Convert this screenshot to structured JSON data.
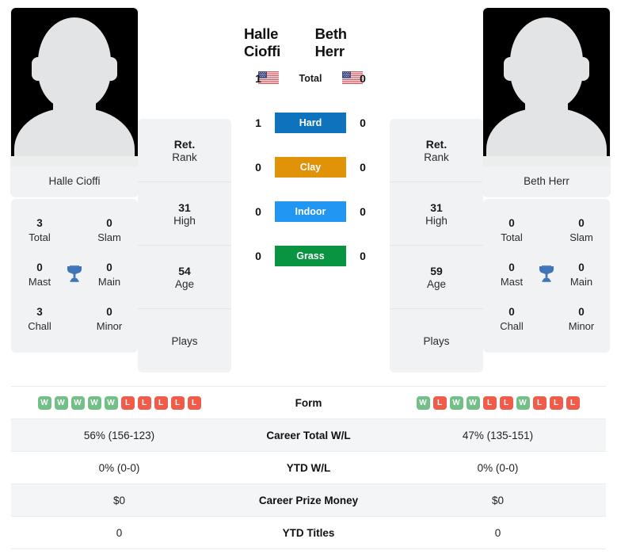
{
  "players": {
    "left": {
      "name": "Halle Cioffi",
      "card_name": "Halle Cioffi",
      "flag": "us-flag-icon",
      "titles": {
        "total": {
          "value": "3",
          "label": "Total"
        },
        "slam": {
          "value": "0",
          "label": "Slam"
        },
        "mast": {
          "value": "0",
          "label": "Mast"
        },
        "main": {
          "value": "0",
          "label": "Main"
        },
        "chall": {
          "value": "3",
          "label": "Chall"
        },
        "minor": {
          "value": "0",
          "label": "Minor"
        }
      },
      "info": {
        "rank_value": "Ret.",
        "rank_label": "Rank",
        "high_value": "31",
        "high_label": "High",
        "age_value": "54",
        "age_label": "Age",
        "plays_label": "Plays"
      },
      "form": [
        "W",
        "W",
        "W",
        "W",
        "W",
        "L",
        "L",
        "L",
        "L",
        "L"
      ],
      "career_total_wl": "56% (156-123)",
      "ytd_wl": "0% (0-0)",
      "career_prize_money": "$0",
      "ytd_titles": "0"
    },
    "right": {
      "name": "Beth Herr",
      "card_name": "Beth Herr",
      "flag": "us-flag-icon",
      "titles": {
        "total": {
          "value": "0",
          "label": "Total"
        },
        "slam": {
          "value": "0",
          "label": "Slam"
        },
        "mast": {
          "value": "0",
          "label": "Mast"
        },
        "main": {
          "value": "0",
          "label": "Main"
        },
        "chall": {
          "value": "0",
          "label": "Chall"
        },
        "minor": {
          "value": "0",
          "label": "Minor"
        }
      },
      "info": {
        "rank_value": "Ret.",
        "rank_label": "Rank",
        "high_value": "31",
        "high_label": "High",
        "age_value": "59",
        "age_label": "Age",
        "plays_label": "Plays"
      },
      "form": [
        "W",
        "L",
        "W",
        "W",
        "L",
        "L",
        "W",
        "L",
        "L",
        "L"
      ],
      "career_total_wl": "47% (135-151)",
      "ytd_wl": "0% (0-0)",
      "career_prize_money": "$0",
      "ytd_titles": "0"
    }
  },
  "surfaces": [
    {
      "label": "Total",
      "left": "1",
      "right": "0",
      "color": "transparent",
      "text_color": "#1a1a1a"
    },
    {
      "label": "Hard",
      "left": "1",
      "right": "0",
      "color": "#0f72bd",
      "text_color": "#ffffff"
    },
    {
      "label": "Clay",
      "left": "0",
      "right": "0",
      "color": "#e09209",
      "text_color": "#ffffff"
    },
    {
      "label": "Indoor",
      "left": "0",
      "right": "0",
      "color": "#2196f3",
      "text_color": "#ffffff"
    },
    {
      "label": "Grass",
      "left": "0",
      "right": "0",
      "color": "#089440",
      "text_color": "#ffffff"
    }
  ],
  "table_rows": [
    {
      "label": "Form",
      "type": "form"
    },
    {
      "label": "Career Total W/L",
      "type": "text",
      "key": "career_total_wl"
    },
    {
      "label": "YTD W/L",
      "type": "text",
      "key": "ytd_wl"
    },
    {
      "label": "Career Prize Money",
      "type": "text",
      "key": "career_prize_money"
    },
    {
      "label": "YTD Titles",
      "type": "text",
      "key": "ytd_titles"
    }
  ],
  "colors": {
    "hard": "#0f72bd",
    "clay": "#e09209",
    "indoor": "#2196f3",
    "grass": "#089440",
    "win_badge": "#72c087",
    "loss_badge": "#f15b4a",
    "card_bg": "#f1f2f3",
    "row_alt_bg": "#f4f5f6"
  },
  "icons": {
    "trophy": "trophy-icon",
    "flag": "us-flag-icon"
  }
}
